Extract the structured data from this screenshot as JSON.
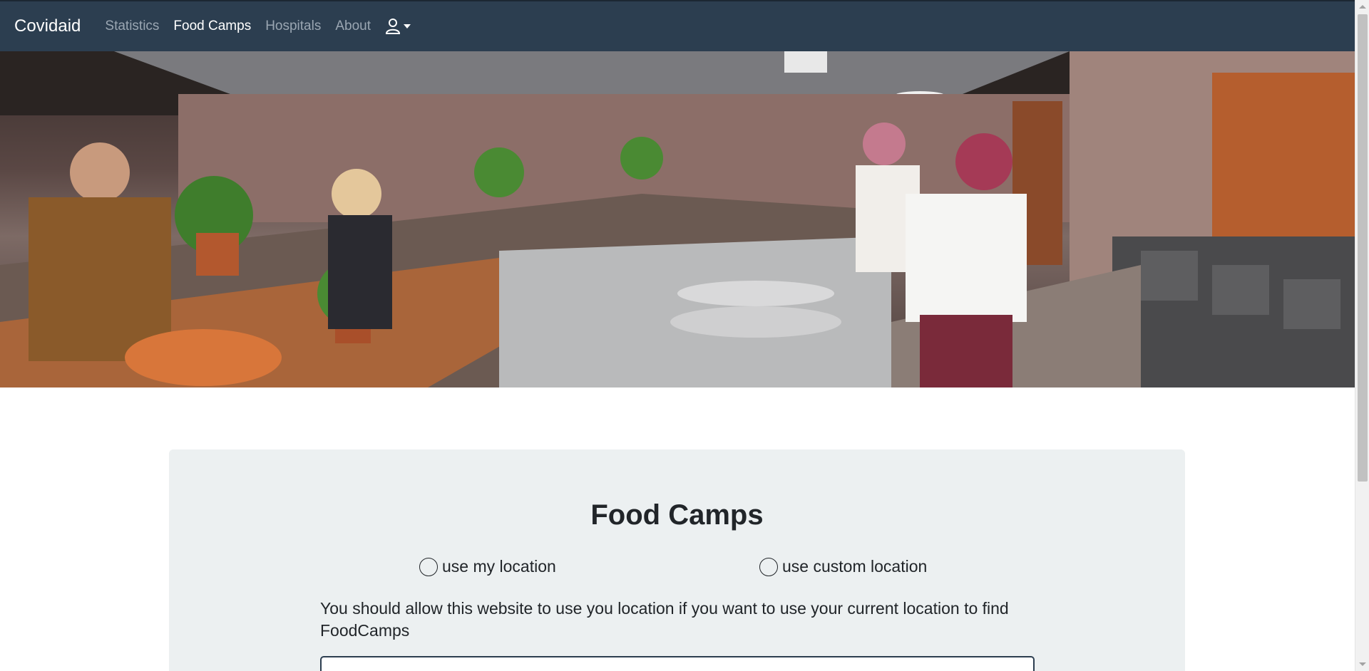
{
  "navbar": {
    "brand": "Covidaid",
    "links": [
      {
        "label": "Statistics",
        "active": false
      },
      {
        "label": "Food Camps",
        "active": true
      },
      {
        "label": "Hospitals",
        "active": false
      },
      {
        "label": "About",
        "active": false
      }
    ],
    "user_icon": "user-icon",
    "background": "#2c3e50"
  },
  "hero": {
    "image": "restaurant-kitchen-photo"
  },
  "main": {
    "title": "Food Camps",
    "radio_options": [
      {
        "label": "use my location"
      },
      {
        "label": "use custom location"
      }
    ],
    "hint": "You should allow this website to use you location if you want to use your current location to find FoodCamps",
    "input_value": ""
  }
}
